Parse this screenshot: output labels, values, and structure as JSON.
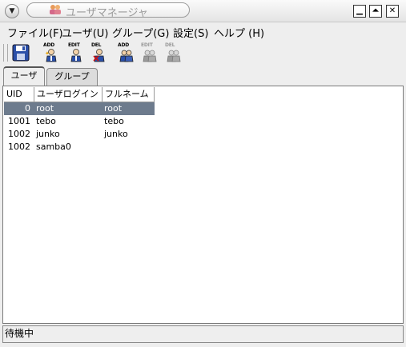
{
  "window": {
    "title": "ユーザマネージャ",
    "controls": {
      "minimize": "▁",
      "maximize": "⏶",
      "close": "✕"
    }
  },
  "menubar": {
    "items": [
      {
        "label": "ファイル(F)"
      },
      {
        "label": "ユーザ(U)"
      },
      {
        "label": "グループ(G)"
      },
      {
        "label": "設定(S)"
      },
      {
        "label": "ヘルプ (H)"
      }
    ]
  },
  "toolbar": {
    "buttons": [
      {
        "name": "save",
        "label": ""
      },
      {
        "name": "user-add",
        "label": "ADD"
      },
      {
        "name": "user-edit",
        "label": "EDIT"
      },
      {
        "name": "user-delete",
        "label": "DEL"
      },
      {
        "name": "group-add",
        "label": "ADD"
      },
      {
        "name": "group-edit",
        "label": "EDIT"
      },
      {
        "name": "group-delete",
        "label": "DEL"
      }
    ]
  },
  "tabs": [
    {
      "label": "ユーザ",
      "active": true
    },
    {
      "label": "グループ",
      "active": false
    }
  ],
  "table": {
    "columns": [
      "UID",
      "ユーザログイン",
      "フルネーム"
    ],
    "rows": [
      {
        "uid": "0",
        "login": "root",
        "fullname": "root",
        "selected": true
      },
      {
        "uid": "1001",
        "login": "tebo",
        "fullname": "tebo",
        "selected": false
      },
      {
        "uid": "1002",
        "login": "junko",
        "fullname": "junko",
        "selected": false
      },
      {
        "uid": "1002",
        "login": "samba0",
        "fullname": "",
        "selected": false
      }
    ]
  },
  "status": {
    "text": "待機中"
  },
  "colors": {
    "selection": "#6d7b8d",
    "toolbar_icon_blue": "#2a4fa8"
  }
}
